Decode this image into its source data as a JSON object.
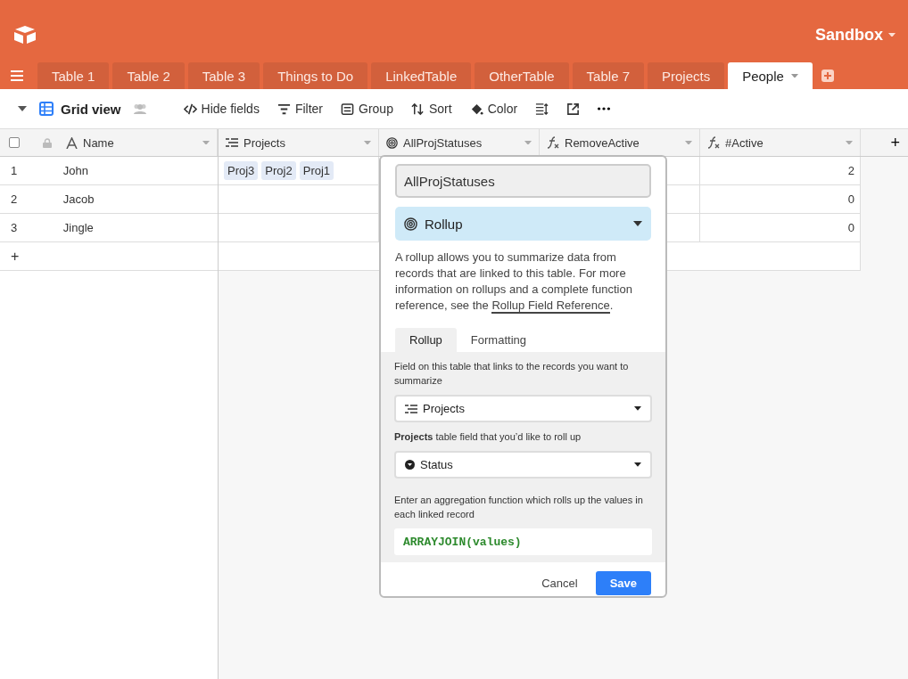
{
  "app": {
    "workspace": "Sandbox"
  },
  "tabs": [
    {
      "label": "Table 1",
      "selected": false
    },
    {
      "label": "Table 2",
      "selected": false
    },
    {
      "label": "Table 3",
      "selected": false
    },
    {
      "label": "Things to Do",
      "selected": false
    },
    {
      "label": "LinkedTable",
      "selected": false
    },
    {
      "label": "OtherTable",
      "selected": false
    },
    {
      "label": "Table 7",
      "selected": false
    },
    {
      "label": "Projects",
      "selected": false
    },
    {
      "label": "People",
      "selected": true
    }
  ],
  "toolbar": {
    "view": "Grid view",
    "items": [
      {
        "kind": "hide",
        "label": "Hide fields"
      },
      {
        "kind": "filter",
        "label": "Filter"
      },
      {
        "kind": "group",
        "label": "Group"
      },
      {
        "kind": "sort",
        "label": "Sort"
      },
      {
        "kind": "color",
        "label": "Color"
      },
      {
        "kind": "height"
      },
      {
        "kind": "share"
      },
      {
        "kind": "more"
      }
    ]
  },
  "table": {
    "columns": [
      {
        "kind": "text",
        "name": "Name"
      },
      {
        "kind": "link",
        "name": "Projects"
      },
      {
        "kind": "rollup",
        "name": "AllProjStatuses"
      },
      {
        "kind": "formula",
        "name": "RemoveActive"
      },
      {
        "kind": "formula",
        "name": "#Active"
      }
    ],
    "rows": [
      {
        "number": "1",
        "name": "John",
        "projects": [
          "Proj3",
          "Proj2",
          "Proj1"
        ],
        "active": "2"
      },
      {
        "number": "2",
        "name": "Jacob",
        "projects": [],
        "active": "0"
      },
      {
        "number": "3",
        "name": "Jingle",
        "projects": [],
        "active": "0"
      }
    ],
    "select_all": {
      "checked": false
    },
    "add_row": "+",
    "add_column": "+"
  },
  "popup": {
    "field_name": "AllProjStatuses",
    "field_type": "Rollup",
    "description": "A rollup allows you to summarize data from records that are linked to this table. For more information on rollups and a complete function reference, see the",
    "link": "Rollup Field Reference",
    "description_end": ".",
    "tabs": [
      {
        "label": "Rollup",
        "selected": true
      },
      {
        "label": "Formatting",
        "selected": false
      }
    ],
    "link_label": "Field on this table that links to the records you want to summarize",
    "link_field": "Projects",
    "rollup_label": "**Projects** table field that you’d like to roll up",
    "rollup_field": "Status",
    "aggregation_label": "Enter an aggregation function which rolls up the values in each linked record",
    "formula": "ARRAYJOIN(values)",
    "cancel": "Cancel",
    "save": "Save"
  }
}
